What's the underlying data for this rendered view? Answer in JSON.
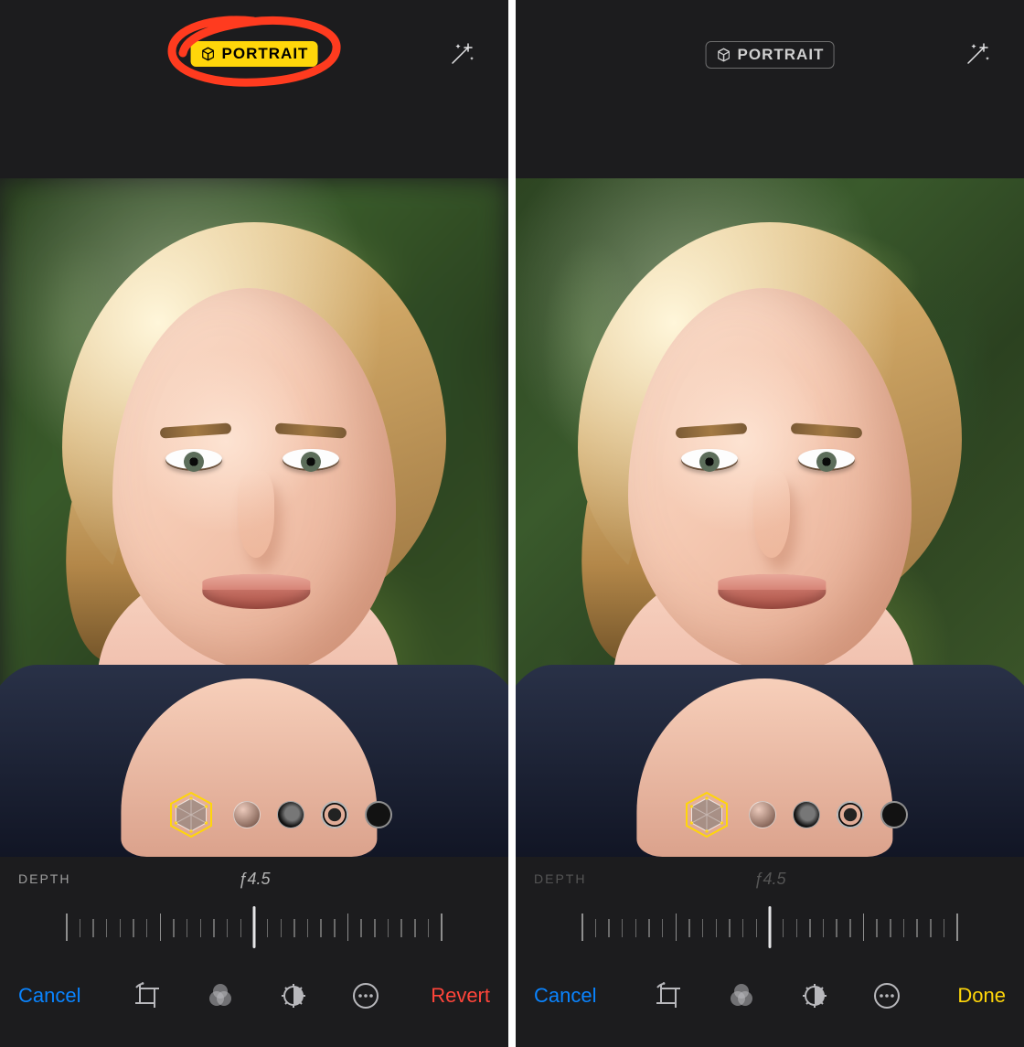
{
  "left": {
    "portrait_badge": {
      "label": "PORTRAIT",
      "state": "active"
    },
    "magic": "auto-enhance",
    "annotation": {
      "circled": true
    },
    "depth": {
      "label": "DEPTH",
      "value": "ƒ4.5"
    },
    "lighting": {
      "selected_index": 0,
      "options": [
        "natural-light",
        "studio-light",
        "contour-light",
        "stage-light",
        "stage-light-mono"
      ]
    },
    "toolbar": {
      "cancel_label": "Cancel",
      "revert_label": "Revert",
      "icons": [
        "crop-rotate-icon",
        "filters-icon",
        "adjust-icon",
        "more-icon"
      ]
    }
  },
  "right": {
    "portrait_badge": {
      "label": "PORTRAIT",
      "state": "inactive"
    },
    "magic": "auto-enhance",
    "depth": {
      "label": "DEPTH",
      "value": "ƒ4.5",
      "dimmed": true
    },
    "lighting": {
      "selected_index": 0,
      "options": [
        "natural-light",
        "studio-light",
        "contour-light",
        "stage-light",
        "stage-light-mono"
      ]
    },
    "toolbar": {
      "cancel_label": "Cancel",
      "done_label": "Done",
      "icons": [
        "crop-rotate-icon",
        "filters-icon",
        "adjust-icon",
        "more-icon"
      ]
    }
  },
  "photo": {
    "subject": "person with blond hair looking up to the right",
    "background": "green foliage",
    "left_background_blurred": true,
    "right_background_blurred": false
  },
  "colors": {
    "accent_yellow": "#ffd60a",
    "ios_blue": "#0a84ff",
    "ios_red": "#ff453a",
    "panel_bg": "#1c1c1e",
    "annotation_red": "#ff3b1f"
  }
}
